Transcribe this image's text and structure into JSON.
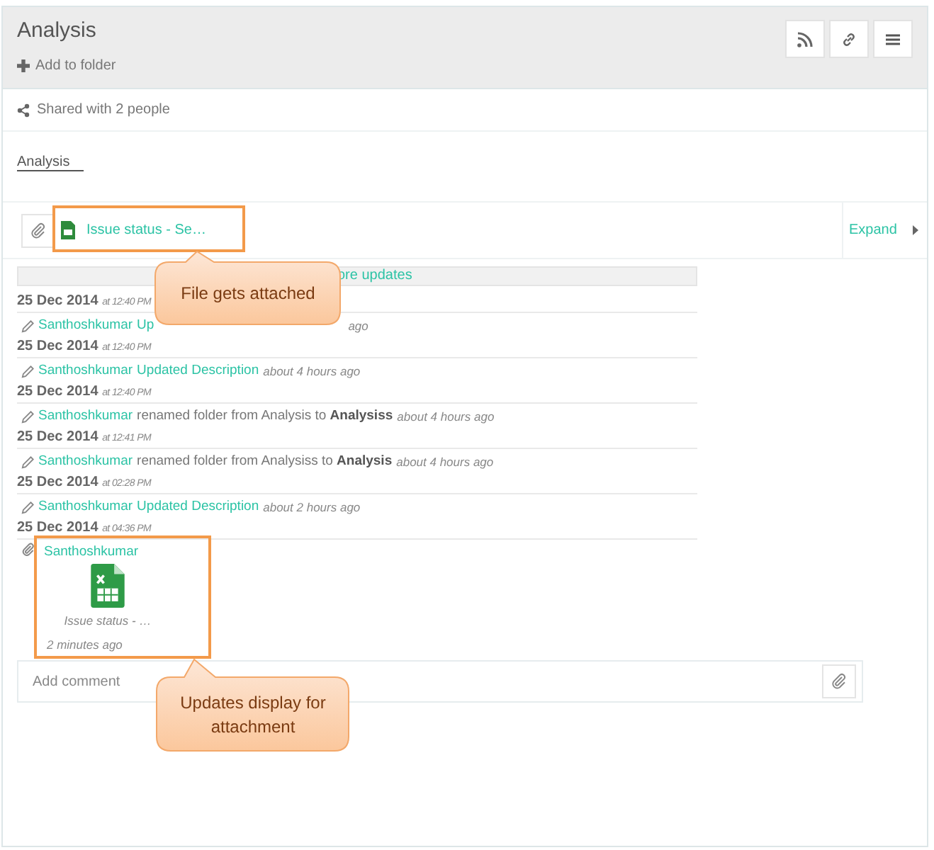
{
  "header": {
    "title": "Analysis",
    "add_to_folder": "Add to folder",
    "buttons": [
      {
        "kind": "rss"
      },
      {
        "kind": "link"
      },
      {
        "kind": "menu"
      }
    ]
  },
  "shared": "Shared with 2 people",
  "description": "Analysis",
  "attachment": {
    "file_name": "Issue status - Se…",
    "expand": "Expand"
  },
  "show_more": "ore updates",
  "updates": [
    {
      "date": "25 Dec 2014",
      "time": "at 12:40 PM",
      "kind": "link_change",
      "actor": "Santhoshkumar",
      "action": "Up",
      "ago": "ago"
    },
    {
      "date": "25 Dec 2014",
      "time": "at 12:40 PM",
      "kind": "link_change",
      "actor": "Santhoshkumar",
      "action": "Updated Description",
      "ago": "about 4 hours ago"
    },
    {
      "date": "25 Dec 2014",
      "time": "at 12:40 PM",
      "kind": "text_change",
      "actor": "Santhoshkumar",
      "action": "renamed folder from Analysis to **Analysiss**",
      "ago": "about 4 hours ago"
    },
    {
      "date": "25 Dec 2014",
      "time": "at 12:41 PM",
      "kind": "text_change",
      "actor": "Santhoshkumar",
      "action": "renamed folder from Analysiss to **Analysis**",
      "ago": "about 4 hours ago"
    },
    {
      "date": "25 Dec 2014",
      "time": "at 02:28 PM",
      "kind": "link_change",
      "actor": "Santhoshkumar",
      "action": "Updated Description",
      "ago": "about 2 hours ago"
    },
    {
      "date": "25 Dec 2014",
      "time": "at 04:36 PM",
      "kind": "attachment",
      "actor": "Santhoshkumar",
      "file_caption": "Issue status - …",
      "ago": "2 minutes ago"
    }
  ],
  "comment": {
    "placeholder": "Add comment"
  },
  "callouts": [
    {
      "text": "File gets attached"
    },
    {
      "text": "Updates display for attachment"
    }
  ]
}
